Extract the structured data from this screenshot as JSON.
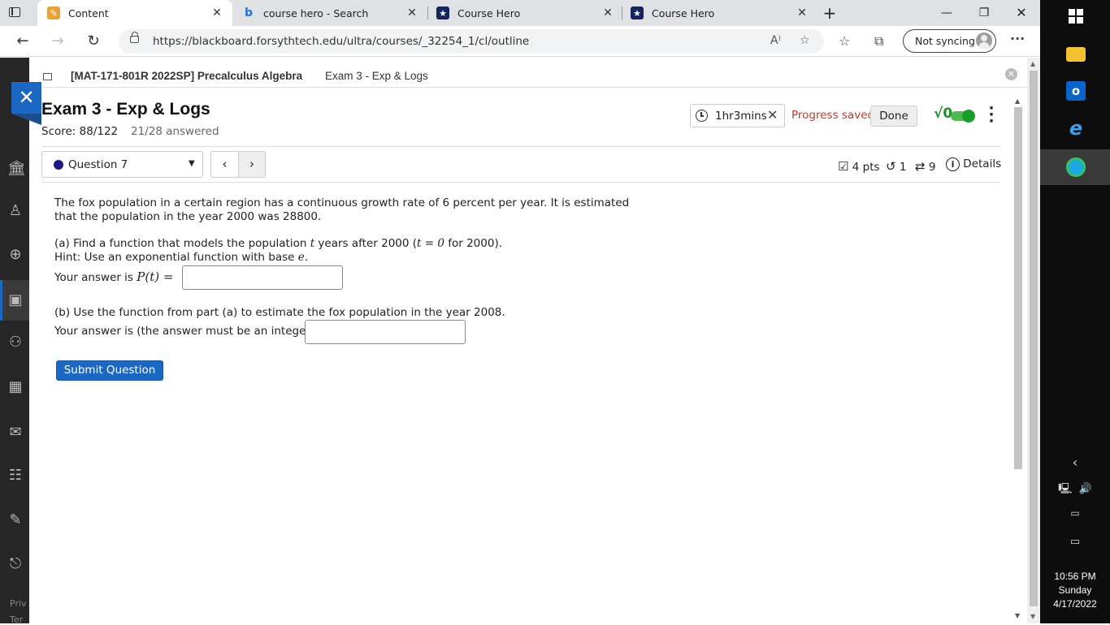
{
  "browser": {
    "tabs": [
      {
        "title": "Content",
        "active": true
      },
      {
        "title": "course hero - Search",
        "active": false
      },
      {
        "title": "Course Hero",
        "active": false
      },
      {
        "title": "Course Hero",
        "active": false
      }
    ],
    "url": "https://blackboard.forsythtech.edu/ultra/courses/_32254_1/cl/outline",
    "sync_label": "Not syncing"
  },
  "breadcrumb": {
    "course": "[MAT-171-801R 2022SP] Precalculus Algebra",
    "page": "Exam 3 - Exp & Logs"
  },
  "exam": {
    "title": "Exam 3 - Exp & Logs",
    "score": "Score: 88/122",
    "answered": "21/28 answered",
    "timer": "1hr3mins",
    "progress": "Progress saved",
    "done_label": "Done",
    "sqrt_symbol": "√0"
  },
  "question_nav": {
    "current": "Question 7"
  },
  "question_meta": {
    "points": "4 pts",
    "retries": "1",
    "attempts": "9",
    "details_label": "Details"
  },
  "question": {
    "stem_line1": "The fox population in a certain region has a continuous growth rate of 6 percent per year. It is estimated",
    "stem_line2": "that the population in the year 2000 was 28800.",
    "part_a_pre": "(a) Find a function that models the population ",
    "part_a_var": "t",
    "part_a_mid": " years after 2000 (",
    "part_a_eq": "t = 0",
    "part_a_post": " for 2000).",
    "hint_pre": "Hint: Use an exponential function with base ",
    "hint_base": "e",
    "hint_post": ".",
    "answer_a_prefix": "Your answer is ",
    "answer_a_math": "P(t) =",
    "part_b": "(b) Use the function from part (a) to estimate the fox population in the year 2008.",
    "answer_b_prefix": "Your answer is (the answer must be an integer)",
    "answer_a_value": "",
    "answer_b_value": "",
    "submit_label": "Submit Question"
  },
  "sidebar": {
    "footer_privacy": "Priv",
    "footer_terms": "Ter"
  },
  "taskbar": {
    "time": "10:56 PM",
    "day": "Sunday",
    "date": "4/17/2022"
  },
  "colors": {
    "accent": "#1c67c1",
    "progress_saved": "#c0392b",
    "sqrt_green": "#1a8f2a"
  }
}
